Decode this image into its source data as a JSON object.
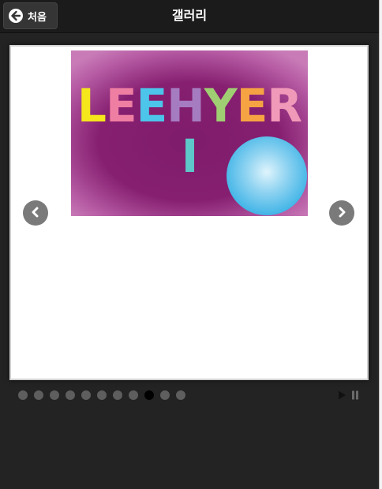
{
  "header": {
    "back_label": "처음",
    "title": "갤러리"
  },
  "slide": {
    "logo_letters": [
      {
        "char": "L",
        "color": "#f6e61c"
      },
      {
        "char": "E",
        "color": "#ef7ea3"
      },
      {
        "char": "E",
        "color": "#4dc4ea"
      },
      {
        "char": "H",
        "color": "#a67cc1"
      },
      {
        "char": "Y",
        "color": "#9fcf72"
      },
      {
        "char": "E",
        "color": "#f6a443"
      },
      {
        "char": "R",
        "color": "#f199b8"
      },
      {
        "char": "I",
        "color": "#5ec7c9"
      }
    ]
  },
  "pagination": {
    "count": 11,
    "active_index": 8
  },
  "controls": {
    "play_icon": "play-icon",
    "pause_icon": "pause-icon"
  },
  "colors": {
    "background": "#232323",
    "slide_bg": "#861f70",
    "arrow_bg": "#7a7a7a",
    "dot_inactive": "#5e5e5e",
    "dot_active": "#000000"
  }
}
